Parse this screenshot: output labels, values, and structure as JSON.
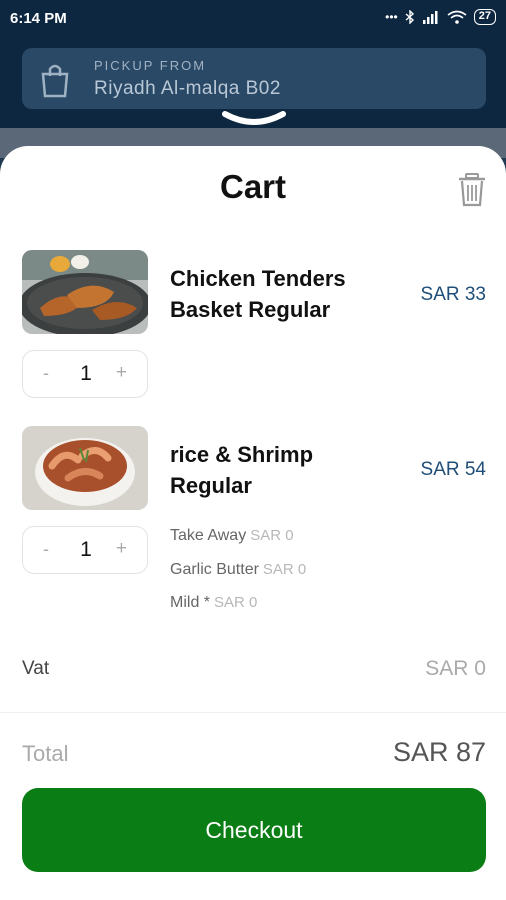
{
  "status_bar": {
    "time": "6:14 PM",
    "battery": "27"
  },
  "header": {
    "pickup_label": "PICKUP FROM",
    "pickup_location": "Riyadh  Al-malqa B02"
  },
  "cart": {
    "title": "Cart",
    "items": [
      {
        "name": "Chicken Tenders Basket Regular",
        "price": "SAR 33",
        "quantity": "1",
        "options": []
      },
      {
        "name": "rice & Shrimp Regular",
        "price": "SAR 54",
        "quantity": "1",
        "options": [
          {
            "label": "Take Away",
            "price": "SAR 0"
          },
          {
            "label": "Garlic Butter",
            "price": "SAR 0"
          },
          {
            "label": "Mild *",
            "price": "SAR 0"
          }
        ]
      }
    ],
    "stepper": {
      "minus": "-",
      "plus": "+"
    },
    "vat_label": "Vat",
    "vat_value": "SAR 0",
    "total_label": "Total",
    "total_value": "SAR 87",
    "checkout_label": "Checkout"
  },
  "colors": {
    "header_bg": "#0e2740",
    "price": "#1f4e79",
    "checkout_bg": "#0a7d14"
  },
  "icons": [
    "shopping-bag-icon",
    "chevron-down-icon",
    "trash-icon",
    "wifi-icon",
    "signal-icon",
    "bluetooth-icon"
  ]
}
